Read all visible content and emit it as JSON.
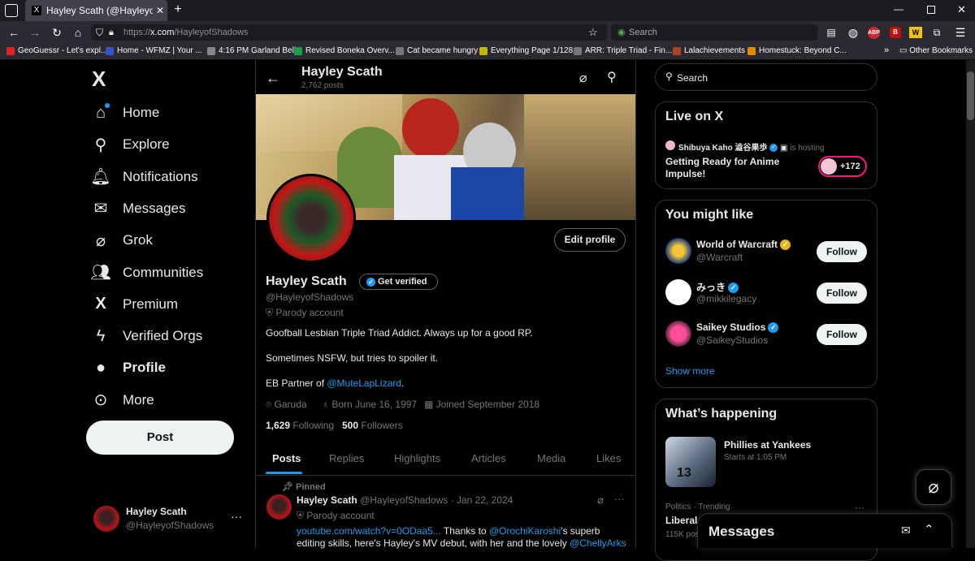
{
  "browser": {
    "tab_title": "Hayley Scath (@HayleyofShadows",
    "url_prefix": "https://",
    "url_host": "x.com",
    "url_path": "/HayleyofShadows",
    "search_placeholder": "Search",
    "new_tab": "+",
    "bookmarks": [
      {
        "label": "GeoGuessr - Let's expl...",
        "color": "#e02424"
      },
      {
        "label": "Home - WFMZ | Your ...",
        "color": "#3355cc"
      },
      {
        "label": "4:16 PM Garland Bell",
        "color": "#888888"
      },
      {
        "label": "Revised Boneka Overv...",
        "color": "#1e9e4a"
      },
      {
        "label": "Cat became hungry",
        "color": "#777777"
      },
      {
        "label": "Everything Page 1/128",
        "color": "#c8b400"
      },
      {
        "label": "ARR: Triple Triad - Fin...",
        "color": "#777777"
      },
      {
        "label": "Lalachievements",
        "color": "#aa4422"
      },
      {
        "label": "Homestuck: Beyond C...",
        "color": "#e08a00"
      }
    ],
    "other_bookmarks": "Other Bookmarks"
  },
  "nav": {
    "logo": "X",
    "items": [
      {
        "label": "Home",
        "icon": "home-icon"
      },
      {
        "label": "Explore",
        "icon": "search-icon"
      },
      {
        "label": "Notifications",
        "icon": "bell-icon"
      },
      {
        "label": "Messages",
        "icon": "envelope-icon"
      },
      {
        "label": "Grok",
        "icon": "grok-icon"
      },
      {
        "label": "Communities",
        "icon": "communities-icon"
      },
      {
        "label": "Premium",
        "icon": "x-premium-icon"
      },
      {
        "label": "Verified Orgs",
        "icon": "lightning-icon"
      },
      {
        "label": "Profile",
        "icon": "person-icon"
      },
      {
        "label": "More",
        "icon": "more-circle-icon"
      }
    ],
    "post_label": "Post",
    "account_name": "Hayley Scath",
    "account_handle": "@HayleyofShadows"
  },
  "profile": {
    "header_name": "Hayley Scath",
    "post_count": "2,762 posts",
    "edit_profile": "Edit profile",
    "name": "Hayley Scath",
    "get_verified": "Get verified",
    "handle": "@HayleyofShadows",
    "parody": "Parody account",
    "bio": "Goofball Lesbian Triple Triad Addict. Always up for a good RP.",
    "bio2": "Sometimes NSFW, but tries to spoiler it.",
    "bio3_prefix": "EB Partner of ",
    "bio3_link": "@MuteLapLizard",
    "bio3_suffix": ".",
    "location": "Garuda",
    "born": "Born June 16, 1997",
    "joined": "Joined September 2018",
    "following_count": "1,629",
    "following_label": "Following",
    "followers_count": "500",
    "followers_label": "Followers",
    "tabs": [
      "Posts",
      "Replies",
      "Highlights",
      "Articles",
      "Media",
      "Likes"
    ]
  },
  "pinned_post": {
    "pinned_label": "Pinned",
    "name": "Hayley Scath",
    "handle_date": "@HayleyofShadows · Jan 22, 2024",
    "parody": "Parody account",
    "link": "youtube.com/watch?v=0ODaa5...",
    "text1": " Thanks to ",
    "mention1": "@OrochiKaroshi",
    "text2": "'s superb",
    "line2": "editing skills, here's Hayley's MV debut, with her and the lovely ",
    "mention2": "@ChellyArks"
  },
  "right": {
    "search_placeholder": "Search",
    "live_title": "Live on X",
    "live_host": "Shibuya Kaho 澁谷果歩",
    "live_hosting": "is hosting",
    "live_event": "Getting Ready for Anime Impulse!",
    "live_count": "+172",
    "might_like_title": "You might like",
    "suggestions": [
      {
        "name": "World of Warcraft",
        "handle": "@Warcraft",
        "follow": "Follow"
      },
      {
        "name": "みっき",
        "handle": "@mikkilegacy",
        "follow": "Follow"
      },
      {
        "name": "Saikey Studios",
        "handle": "@SaikeyStudios",
        "follow": "Follow"
      }
    ],
    "show_more": "Show more",
    "happening_title": "What’s happening",
    "trend1_title": "Phillies at Yankees",
    "trend1_sub": "Starts at 1:05 PM",
    "trend2_meta": "Politics · Trending",
    "trend2_title": "Liberal",
    "trend2_count": "115K pos"
  },
  "messages_drawer": {
    "title": "Messages"
  },
  "colors": {
    "accent": "#1d9bf0",
    "gold": "#e2b719",
    "bg": "#000000"
  }
}
